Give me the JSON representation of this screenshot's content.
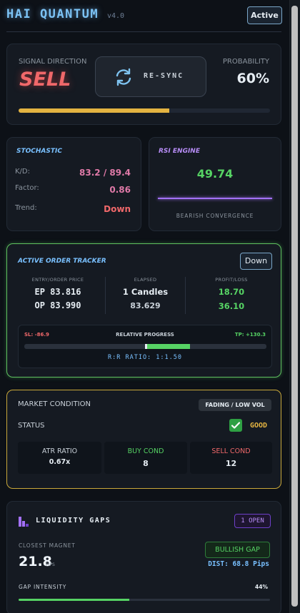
{
  "header": {
    "title": "HAI QUANTUM",
    "version": "v4.0",
    "status_badge": "Active"
  },
  "signal": {
    "direction_label": "SIGNAL DIRECTION",
    "direction": "SELL",
    "resync_label": "RE-SYNC",
    "probability_label": "PROBABILITY",
    "probability": "60%",
    "probability_fraction": 0.6
  },
  "stochastic": {
    "title": "STOCHASTIC",
    "kd_label": "K/D:",
    "kd_value": "83.2 / 89.4",
    "factor_label": "Factor:",
    "factor_value": "0.86",
    "trend_label": "Trend:",
    "trend_value": "Down"
  },
  "rsi": {
    "title": "RSI ENGINE",
    "value": "49.74",
    "note": "BEARISH CONVERGENCE"
  },
  "order": {
    "title": "ACTIVE ORDER TRACKER",
    "direction_badge": "Down",
    "col1_label": "ENTRY/ORDER PRICE",
    "ep": "EP 83.816",
    "op": "OP 83.990",
    "col2_label": "ELAPSED",
    "elapsed": "1 Candles",
    "elapsed_price": "83.629",
    "col3_label": "PROFIT/LOSS",
    "pl1": "18.70",
    "pl2": "36.10",
    "sl": "SL: -86.9",
    "progress_label": "RELATIVE PROGRESS",
    "tp": "TP: +130.3",
    "progress_fraction": 0.36,
    "rr": "R:R RATIO: 1:1.50"
  },
  "market": {
    "title": "MARKET CONDITION",
    "badge": "FADING / LOW VOL",
    "status_label": "STATUS",
    "status_value": "GOOD",
    "atr_label": "ATR RATIO",
    "atr_value": "0.67x",
    "buy_label": "BUY COND",
    "buy_value": "8",
    "sell_label": "SELL COND",
    "sell_value": "12"
  },
  "liquidity": {
    "title": "LIQUIDITY GAPS",
    "open_badge": "1 OPEN",
    "magnet_label": "CLOSEST MAGNET",
    "magnet_value": "21.8",
    "magnet_unit": "PIPS",
    "gap_badge": "BULLISH GAP",
    "dist": "DIST: 68.8 Pips",
    "intensity_label": "GAP INTENSITY",
    "intensity": "44%",
    "intensity_fraction": 0.44
  },
  "colors": {
    "accent_blue": "#79c0ff",
    "sell_red": "#f0686a",
    "yellow": "#e3b341",
    "green": "#56d364",
    "purple": "#a371f7"
  }
}
